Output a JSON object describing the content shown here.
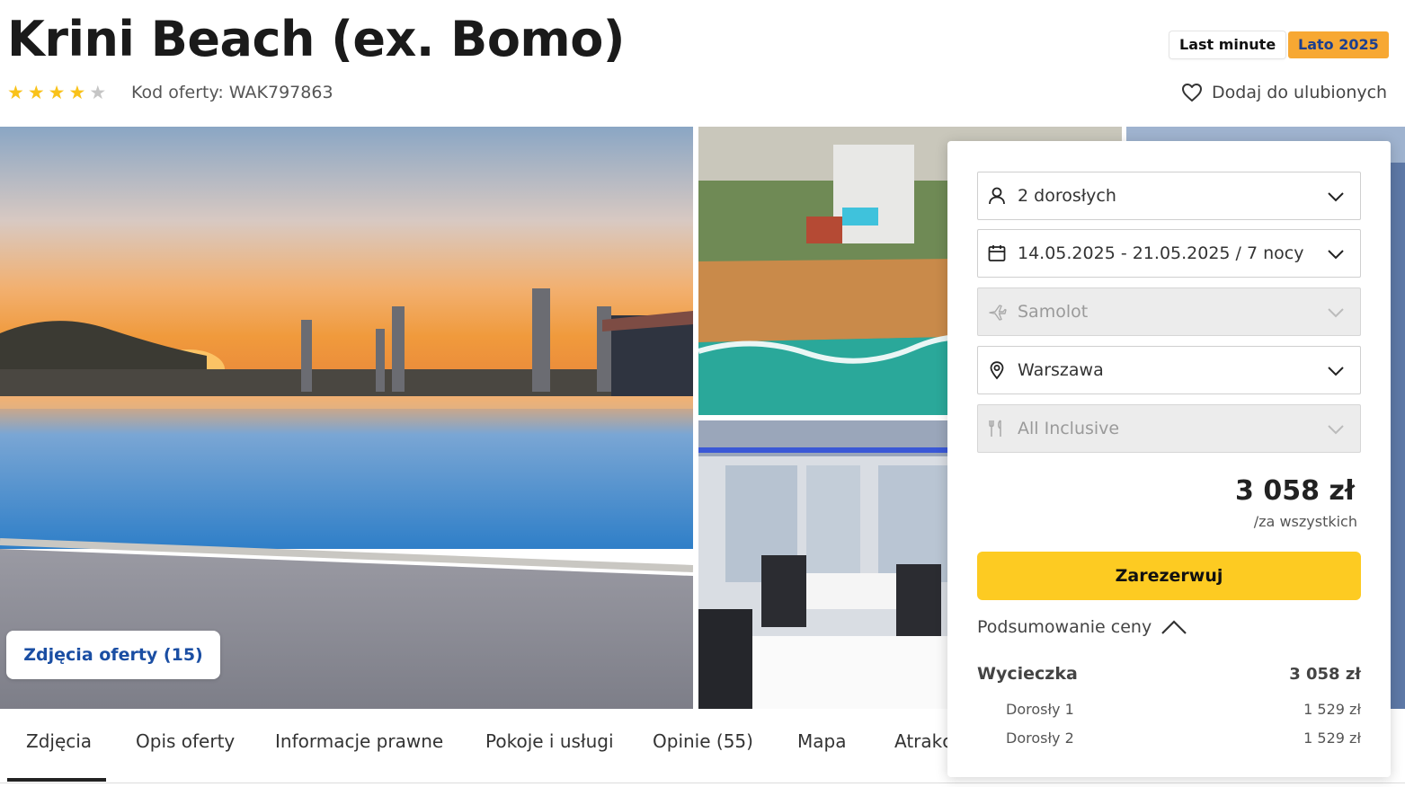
{
  "header": {
    "title": "Krini Beach (ex. Bomo)",
    "rating": {
      "stars": 4,
      "max": 5
    },
    "offer_code": "Kod oferty: WAK797863",
    "badges": [
      {
        "label": "Last minute",
        "color": "#ffffff"
      },
      {
        "label": "Lato 2025",
        "color": "#f7a833"
      }
    ],
    "favorite_label": "Dodaj do ulubionych"
  },
  "gallery": {
    "photos_button": "Zdjęcia oferty (15)",
    "images": [
      "sunset-pool",
      "aerial-beach-hotel",
      "restaurant-interior",
      "pool-edge"
    ]
  },
  "tabs": [
    {
      "label": "Zdjęcia",
      "active": true
    },
    {
      "label": "Opis oferty"
    },
    {
      "label": "Informacje prawne"
    },
    {
      "label": "Pokoje i usługi"
    },
    {
      "label": "Opinie (55)"
    },
    {
      "label": "Mapa"
    },
    {
      "label": "Atrakcje"
    }
  ],
  "booking": {
    "fields": [
      {
        "icon": "person-icon",
        "value": "2 dorosłych",
        "disabled": false
      },
      {
        "icon": "calendar-icon",
        "value": "14.05.2025 - 21.05.2025 / 7 nocy",
        "disabled": false
      },
      {
        "icon": "plane-icon",
        "value": "Samolot",
        "disabled": true
      },
      {
        "icon": "location-pin-icon",
        "value": "Warszawa",
        "disabled": false
      },
      {
        "icon": "cutlery-icon",
        "value": "All Inclusive",
        "disabled": true
      }
    ],
    "price": "3 058 zł",
    "price_note": "/za wszystkich",
    "reserve_label": "Zarezerwuj",
    "summary_toggle": "Podsumowanie ceny",
    "summary": {
      "trip_label": "Wycieczka",
      "trip_value": "3 058 zł",
      "items": [
        {
          "label": "Dorosły 1",
          "value": "1 529 zł"
        },
        {
          "label": "Dorosły 2",
          "value": "1 529 zł"
        }
      ]
    }
  },
  "colors": {
    "star": "#f9c21a",
    "badge_orange": "#f7a833",
    "reserve_yellow": "#fdcb22",
    "link_blue": "#1a4ea3"
  }
}
